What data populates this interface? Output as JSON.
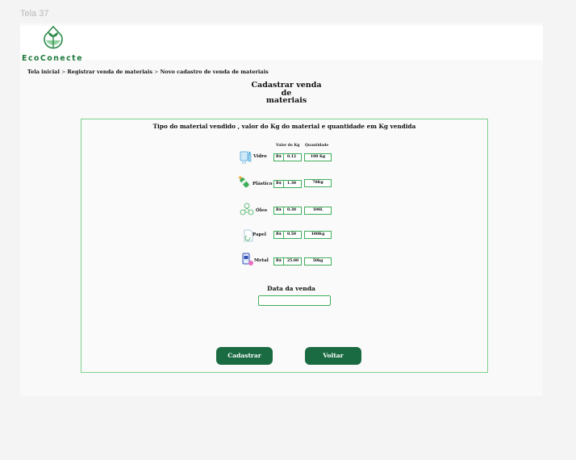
{
  "frame_label": "Tela 37",
  "logo": {
    "text": "EcoConecte",
    "icon": "leaf-drop-logo-icon"
  },
  "breadcrumb": [
    "Tela inicial",
    "Registrar  venda de materiais",
    "Novo cadastro de venda de materiais"
  ],
  "breadcrumb_separator": ">",
  "page_title": [
    "Cadastrar venda",
    "de",
    "materiais"
  ],
  "form": {
    "heading": "Tipo do material vendido , valor do Kg do material e quantidade em Kg vendida",
    "col_price": "Valor do Kg",
    "col_qty": "Quantidade",
    "currency": "R$",
    "materials": [
      {
        "label": "Vidro",
        "price": "0.12",
        "qty": "100 Kg",
        "icon": "glass-bottle-icon"
      },
      {
        "label": "Plástico",
        "price": "1.30",
        "qty": "70Kg",
        "icon": "plastic-bottle-icon"
      },
      {
        "label": "Óleo",
        "price": "0.30",
        "qty": "100L",
        "icon": "oil-recycle-icon"
      },
      {
        "label": "Papel",
        "price": "0.50",
        "qty": "100Kg",
        "icon": "paper-icon"
      },
      {
        "label": "Metal",
        "price": "25.00",
        "qty": "50kg",
        "icon": "metal-can-icon"
      }
    ],
    "date_label": "Data  da venda",
    "date_value": "",
    "submit_label": "Cadastrar",
    "back_label": "Voltar"
  },
  "colors": {
    "accent": "#1a6b42",
    "border": "#3fae5b",
    "logo": "#1e7a3c"
  }
}
